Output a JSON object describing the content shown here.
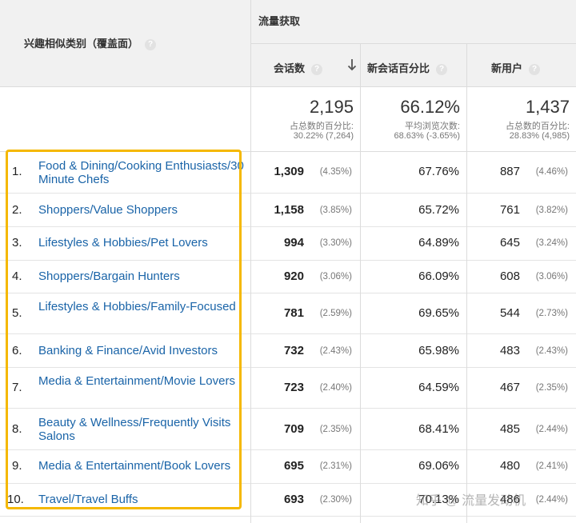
{
  "header": {
    "dimension_label": "兴趣相似类别（覆盖面）",
    "group_label": "流量获取",
    "columns": [
      {
        "label": "会话数",
        "help": "?"
      },
      {
        "label": "新会话百分比",
        "help": "?"
      },
      {
        "label": "新用户",
        "help": "?"
      }
    ],
    "dimension_help": "?"
  },
  "totals": {
    "sessions": {
      "value": "2,195",
      "sub1": "占总数的百分比:",
      "sub2": "30.22% (7,264)"
    },
    "new_session_pct": {
      "value": "66.12%",
      "sub1": "平均浏览次数:",
      "sub2": "68.63% (-3.65%)"
    },
    "new_users": {
      "value": "1,437",
      "sub1": "占总数的百分比:",
      "sub2": "28.83% (4,985)"
    }
  },
  "rows": [
    {
      "num": "1.",
      "name": "Food & Dining/Cooking Enthusiasts/30 Minute Chefs",
      "sessions": "1,309",
      "sessions_pct": "(4.35%)",
      "new_session_pct": "67.76%",
      "new_users": "887",
      "new_users_pct": "(4.46%)"
    },
    {
      "num": "2.",
      "name": "Shoppers/Value Shoppers",
      "sessions": "1,158",
      "sessions_pct": "(3.85%)",
      "new_session_pct": "65.72%",
      "new_users": "761",
      "new_users_pct": "(3.82%)"
    },
    {
      "num": "3.",
      "name": "Lifestyles & Hobbies/Pet Lovers",
      "sessions": "994",
      "sessions_pct": "(3.30%)",
      "new_session_pct": "64.89%",
      "new_users": "645",
      "new_users_pct": "(3.24%)"
    },
    {
      "num": "4.",
      "name": "Shoppers/Bargain Hunters",
      "sessions": "920",
      "sessions_pct": "(3.06%)",
      "new_session_pct": "66.09%",
      "new_users": "608",
      "new_users_pct": "(3.06%)"
    },
    {
      "num": "5.",
      "name": "Lifestyles & Hobbies/Family-Focused",
      "sessions": "781",
      "sessions_pct": "(2.59%)",
      "new_session_pct": "69.65%",
      "new_users": "544",
      "new_users_pct": "(2.73%)"
    },
    {
      "num": "6.",
      "name": "Banking & Finance/Avid Investors",
      "sessions": "732",
      "sessions_pct": "(2.43%)",
      "new_session_pct": "65.98%",
      "new_users": "483",
      "new_users_pct": "(2.43%)"
    },
    {
      "num": "7.",
      "name": "Media & Entertainment/Movie Lovers",
      "sessions": "723",
      "sessions_pct": "(2.40%)",
      "new_session_pct": "64.59%",
      "new_users": "467",
      "new_users_pct": "(2.35%)"
    },
    {
      "num": "8.",
      "name": "Beauty & Wellness/Frequently Visits Salons",
      "sessions": "709",
      "sessions_pct": "(2.35%)",
      "new_session_pct": "68.41%",
      "new_users": "485",
      "new_users_pct": "(2.44%)"
    },
    {
      "num": "9.",
      "name": "Media & Entertainment/Book Lovers",
      "sessions": "695",
      "sessions_pct": "(2.31%)",
      "new_session_pct": "69.06%",
      "new_users": "480",
      "new_users_pct": "(2.41%)"
    },
    {
      "num": "10.",
      "name": "Travel/Travel Buffs",
      "sessions": "693",
      "sessions_pct": "(2.30%)",
      "new_session_pct": "70.13%",
      "new_users": "486",
      "new_users_pct": "(2.44%)"
    }
  ],
  "watermark": "知乎 @ 流量发动机",
  "colors": {
    "link": "#1a64a8",
    "highlight": "#f5b800",
    "header_bg": "#f1f1f1"
  }
}
